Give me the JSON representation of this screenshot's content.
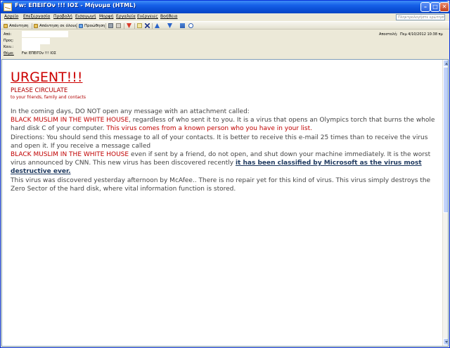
{
  "window": {
    "title": "Fw: ΕΠΕΙΓΟν !!! ΙΟΣ - Μήνυμα (HTML)",
    "min_glyph": "–",
    "max_glyph": "□",
    "close_glyph": "✕"
  },
  "menu": {
    "items": [
      "Αρχείο",
      "Επεξεργασία",
      "Προβολή",
      "Εισαγωγή",
      "Μορφή",
      "Εργαλεία",
      "Ενέργειες",
      "Βοήθεια"
    ],
    "help_placeholder": "Πληκτρολογήστε ερώτηση"
  },
  "toolbar": {
    "reply": "Απάντηση",
    "reply_all": "Απάντηση σε όλους",
    "forward": "Προώθηση"
  },
  "header": {
    "from_label": "Από:",
    "to_label": "Προς:",
    "cc_label": "Κοιν.:",
    "subject_label": "Θέμα:",
    "subject_value": "Fw: ΕΠΕΙΓΟν !!! ΙΟΣ",
    "sent_label": "Αποστολή:",
    "sent_value": "Πεμ 4/10/2012 10:38 πμ"
  },
  "message": {
    "urgent": "URGENT!!!",
    "circulate": "PLEASE CIRCULATE",
    "friends": "to your friends, family and contacts",
    "p1": "In the coming days, DO NOT open any message with an attachment called:",
    "p2_red": "BLACK MUSLIM IN THE WHITE HOUSE",
    "p2_rest": ", regardless of who sent it to you. It is a virus that opens an Olympics torch that burns the whole hard disk C of your computer. ",
    "p2_red2": "This virus comes from a known person who you have in your list.",
    "p3": "Directions: You should send this message to all of your contacts. It is better to receive this e-mail 25 times than to receive the virus and open it. If you receive a message called",
    "p4_red": "BLACK MUSLIM IN THE WHITE HOUSE",
    "p4_rest": " even if sent by a friend, do not open, and shut down your machine immediately.  It is the worst virus announced by CNN. This  new virus has been discovered recently ",
    "p4_bold": "it has been classified by Microsoft as the virus most destructive ever.",
    "p5": "This virus was discovered yesterday afternoon by McAfee..  There is no repair yet for this kind of virus. This virus simply destroys the Zero Sector of the hard disk, where vital information function is stored."
  },
  "colors": {
    "accent_red": "#cc0000",
    "titlebar_blue": "#0b4fd6",
    "body_text": "#444444"
  }
}
